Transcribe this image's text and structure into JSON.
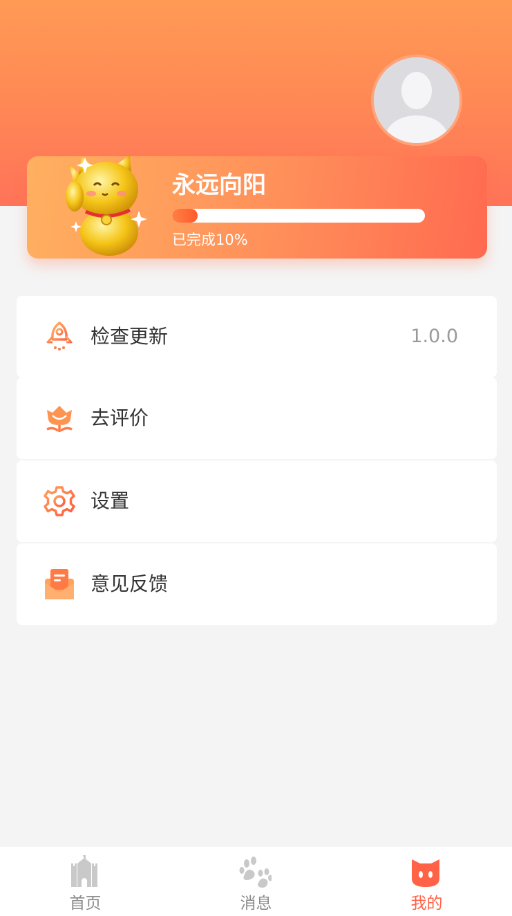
{
  "colors": {
    "header_gradient_top": "#ff9a55",
    "header_gradient_bottom": "#ff7358",
    "accent": "#ff6247",
    "tab_inactive": "#8a8a8a",
    "background": "#f4f4f4"
  },
  "profile": {
    "avatar_icon": "default-avatar-icon",
    "mascot_icon": "lucky-cat-icon",
    "username": "永远向阳",
    "progress_fraction": 0.1,
    "progress_text": "已完成10%"
  },
  "menu": {
    "items": [
      {
        "icon": "rocket-icon",
        "label": "检查更新",
        "value": "1.0.0"
      },
      {
        "icon": "flower-icon",
        "label": "去评价"
      },
      {
        "icon": "gear-icon",
        "label": "设置"
      },
      {
        "icon": "mail-feedback-icon",
        "label": "意见反馈"
      }
    ]
  },
  "tabbar": {
    "tabs": [
      {
        "icon": "castle-icon",
        "label": "首页",
        "active": false
      },
      {
        "icon": "paw-icon",
        "label": "消息",
        "active": false
      },
      {
        "icon": "cat-face-icon",
        "label": "我的",
        "active": true
      }
    ]
  }
}
